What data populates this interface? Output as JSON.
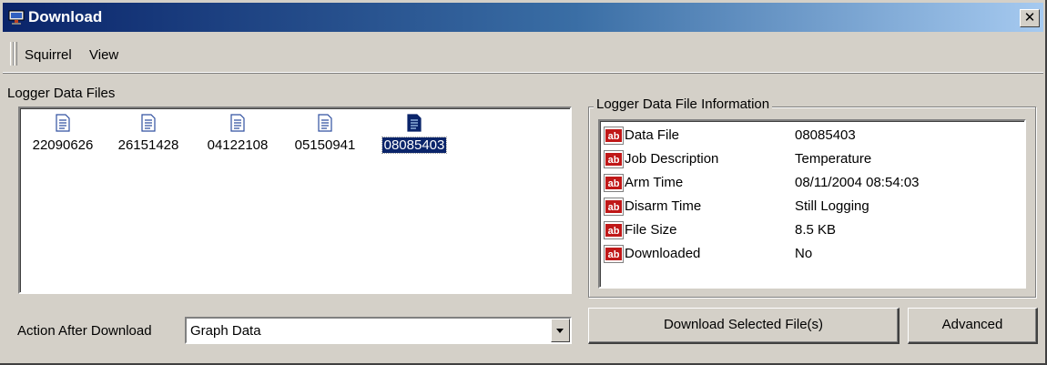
{
  "window": {
    "title": "Download",
    "close_glyph": "✕",
    "title_icon": "squirrel-app-icon"
  },
  "menu": {
    "items": [
      {
        "label": "Squirrel"
      },
      {
        "label": "View"
      }
    ]
  },
  "files_panel": {
    "label": "Logger Data Files",
    "file_icon": "document-icon",
    "files": [
      {
        "name": "22090626",
        "selected": false
      },
      {
        "name": "26151428",
        "selected": false
      },
      {
        "name": "04122108",
        "selected": false
      },
      {
        "name": "05150941",
        "selected": false
      },
      {
        "name": "08085403",
        "selected": true
      }
    ]
  },
  "info_panel": {
    "label": "Logger Data File Information",
    "row_icon": "ab-text-icon",
    "rows": [
      {
        "key": "Data File",
        "value": "08085403"
      },
      {
        "key": "Job Description",
        "value": "Temperature"
      },
      {
        "key": "Arm Time",
        "value": "08/11/2004 08:54:03"
      },
      {
        "key": "Disarm Time",
        "value": "Still Logging"
      },
      {
        "key": "File Size",
        "value": "8.5 KB"
      },
      {
        "key": "Downloaded",
        "value": "No"
      }
    ]
  },
  "action": {
    "label": "Action After Download",
    "selected": "Graph Data"
  },
  "buttons": {
    "download": "Download Selected File(s)",
    "advanced": "Advanced"
  },
  "colors": {
    "face": "#d4d0c8",
    "title_start": "#0a246a",
    "title_end": "#a6caf0",
    "selection": "#0a246a"
  }
}
